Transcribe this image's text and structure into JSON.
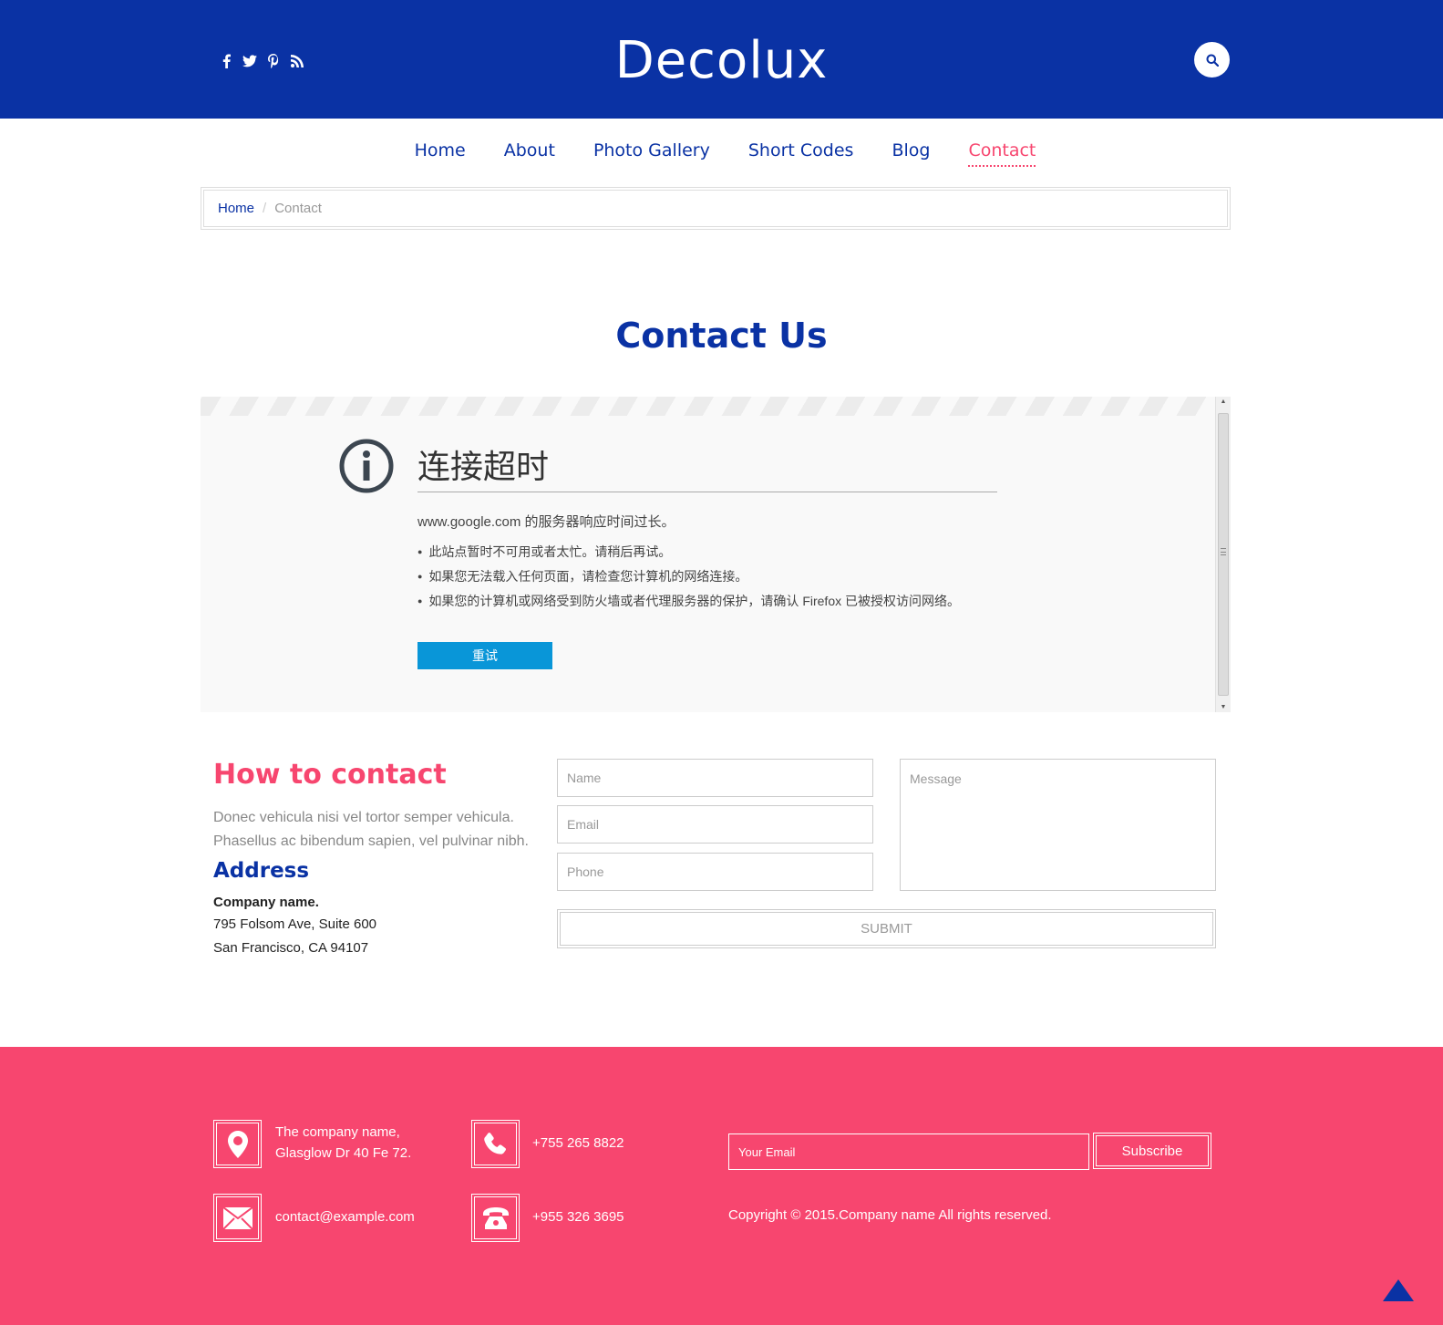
{
  "brand": {
    "name": "Decolux"
  },
  "colors": {
    "primary": "#0a32a4",
    "accent": "#f7466f",
    "retry_button": "#0996d8"
  },
  "social": [
    "facebook-icon",
    "twitter-icon",
    "pinterest-icon",
    "rss-icon"
  ],
  "nav": {
    "items": [
      {
        "label": "Home"
      },
      {
        "label": "About"
      },
      {
        "label": "Photo Gallery"
      },
      {
        "label": "Short Codes"
      },
      {
        "label": "Blog"
      },
      {
        "label": "Contact",
        "active": true
      }
    ]
  },
  "breadcrumb": {
    "home": "Home",
    "separator": "/",
    "current": "Contact"
  },
  "page": {
    "title": "Contact Us"
  },
  "error_frame": {
    "title": "连接超时",
    "description": "www.google.com 的服务器响应时间过长。",
    "items": [
      "此站点暂时不可用或者太忙。请稍后再试。",
      "如果您无法载入任何页面，请检查您计算机的网络连接。",
      "如果您的计算机或网络受到防火墙或者代理服务器的保护，请确认 Firefox 已被授权访问网络。"
    ],
    "retry_label": "重试"
  },
  "contact": {
    "heading": "How to contact",
    "text": "Donec vehicula nisi vel tortor semper vehicula. Phasellus ac bibendum sapien, vel pulvinar nibh.",
    "address_heading": "Address",
    "company": "Company name.",
    "line1": "795 Folsom Ave, Suite 600",
    "line2": "San Francisco, CA 94107"
  },
  "form": {
    "name_placeholder": "Name",
    "email_placeholder": "Email",
    "phone_placeholder": "Phone",
    "message_placeholder": "Message",
    "submit_label": "SUBMIT"
  },
  "footer": {
    "address_line1": "The company name,",
    "address_line2": "Glasglow Dr 40 Fe 72.",
    "phone1": "+755 265 8822",
    "email": "contact@example.com",
    "phone2": "+955 326 3695",
    "email_placeholder": "Your Email",
    "subscribe_label": "Subscribe",
    "copyright": "Copyright © 2015.Company name All rights reserved."
  }
}
